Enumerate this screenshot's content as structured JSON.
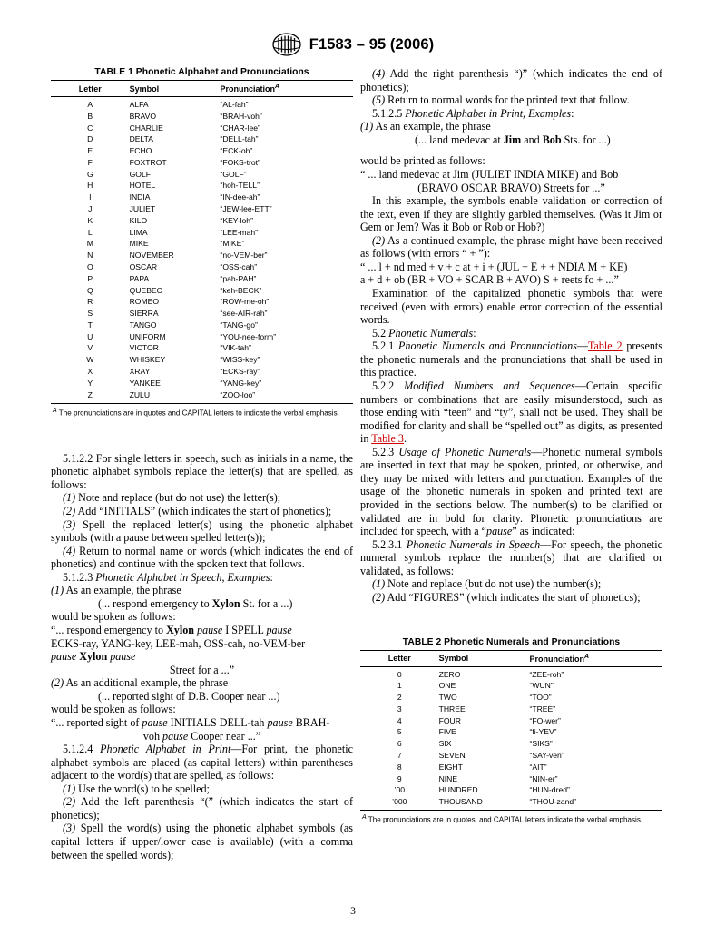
{
  "header": {
    "logo_name": "astm-logo",
    "title": "F1583 – 95 (2006)"
  },
  "page_number": "3",
  "table1": {
    "caption": "TABLE 1  Phonetic Alphabet and Pronunciations",
    "columns": [
      "Letter",
      "Symbol",
      "Pronunciation"
    ],
    "footnote_marker": "A",
    "rows": [
      [
        "A",
        "ALFA",
        "“AL-fah”"
      ],
      [
        "B",
        "BRAVO",
        "“BRAH-voh”"
      ],
      [
        "C",
        "CHARLIE",
        "“CHAR-lee”"
      ],
      [
        "D",
        "DELTA",
        "“DELL-tah”"
      ],
      [
        "E",
        "ECHO",
        "“ECK-oh”"
      ],
      [
        "F",
        "FOXTROT",
        "“FOKS-trot”"
      ],
      [
        "G",
        "GOLF",
        "“GOLF”"
      ],
      [
        "H",
        "HOTEL",
        "“hoh-TELL”"
      ],
      [
        "I",
        "INDIA",
        "“IN-dee-ah”"
      ],
      [
        "J",
        "JULIET",
        "“JEW-lee-ETT”"
      ],
      [
        "K",
        "KILO",
        "“KEY-loh”"
      ],
      [
        "L",
        "LIMA",
        "“LEE-mah”"
      ],
      [
        "M",
        "MIKE",
        "“MIKE”"
      ],
      [
        "N",
        "NOVEMBER",
        "“no-VEM-ber”"
      ],
      [
        "O",
        "OSCAR",
        "“OSS-cah”"
      ],
      [
        "P",
        "PAPA",
        "“pah-PAH”"
      ],
      [
        "Q",
        "QUEBEC",
        "“keh-BECK”"
      ],
      [
        "R",
        "ROMEO",
        "“ROW-me-oh”"
      ],
      [
        "S",
        "SIERRA",
        "“see-AIR-rah”"
      ],
      [
        "T",
        "TANGO",
        "“TANG-go”"
      ],
      [
        "U",
        "UNIFORM",
        "“YOU-nee-form”"
      ],
      [
        "V",
        "VICTOR",
        "“VIK-tah”"
      ],
      [
        "W",
        "WHISKEY",
        "“WISS-key”"
      ],
      [
        "X",
        "XRAY",
        "“ECKS-ray”"
      ],
      [
        "Y",
        "YANKEE",
        "“YANG-key”"
      ],
      [
        "Z",
        "ZULU",
        "“ZOO-loo”"
      ]
    ],
    "footnote": "The pronunciations are in quotes and CAPITAL letters to indicate the verbal emphasis."
  },
  "table2": {
    "caption": "TABLE 2  Phonetic Numerals and Pronunciations",
    "columns": [
      "Letter",
      "Symbol",
      "Pronunciation"
    ],
    "footnote_marker": "A",
    "rows": [
      [
        "0",
        "ZERO",
        "“ZEE-roh”"
      ],
      [
        "1",
        "ONE",
        "“WUN”"
      ],
      [
        "2",
        "TWO",
        "“TOO”"
      ],
      [
        "3",
        "THREE",
        "“TREE”"
      ],
      [
        "4",
        "FOUR",
        "“FO-wer”"
      ],
      [
        "5",
        "FIVE",
        "“fi-YEV”"
      ],
      [
        "6",
        "SIX",
        "“SIKS”"
      ],
      [
        "7",
        "SEVEN",
        "“SAY-ven”"
      ],
      [
        "8",
        "EIGHT",
        "“AIT”"
      ],
      [
        "9",
        "NINE",
        "“NIN-er”"
      ],
      [
        "’00",
        "HUNDRED",
        "“HUN-dred”"
      ],
      [
        "’000",
        "THOUSAND",
        "“THOU-zand”"
      ]
    ],
    "footnote": "The pronunciations are in quotes, and CAPITAL letters indicate the verbal emphasis."
  },
  "left_column": {
    "p_5122": "5.1.2.2 For single letters in speech, such as initials in a name, the phonetic alphabet symbols replace the letter(s) that are spelled, as follows:",
    "p_5122_1_num": "(1)",
    "p_5122_1": "Note and replace (but do not use) the letter(s);",
    "p_5122_2_num": "(2)",
    "p_5122_2": "Add “INITIALS” (which indicates the start of phonetics);",
    "p_5122_3_num": "(3)",
    "p_5122_3": "Spell the replaced letter(s) using the phonetic alphabet symbols (with a pause between spelled letter(s));",
    "p_5122_4_num": "(4)",
    "p_5122_4": "Return to normal name or words (which indicates the end of phonetics) and continue with the spoken text that follows.",
    "h_5123_num": "5.1.2.3",
    "h_5123_title": "Phonetic Alphabet in Speech, Examples",
    "h_5123_colon": ":",
    "ex1_num": "(1)",
    "ex1_lead": "As an example, the phrase",
    "ex1_phrase_a": "(... respond emergency to ",
    "ex1_phrase_bold": "Xylon",
    "ex1_phrase_b": " St. for a ...)",
    "ex1_spoken_lead": "would be spoken as follows:",
    "ex1_spoken_1a": "“... respond emergency to ",
    "ex1_spoken_1b": "Xylon",
    "ex1_spoken_1c": "pause",
    "ex1_spoken_1d": " I SPELL ",
    "ex1_spoken_1e": "pause",
    "ex1_spoken_2": "ECKS-ray, YANG-key, LEE-mah, OSS-cah, no-VEM-ber",
    "ex1_spoken_3a": "pause",
    "ex1_spoken_3b": "Xylon",
    "ex1_spoken_3c": "pause",
    "ex1_spoken_4": "Street for a ...”",
    "ex2_num": "(2)",
    "ex2_lead": "As an additional example, the phrase",
    "ex2_phrase": "(... reported sight of D.B. Cooper near ...)",
    "ex2_spoken_lead": "would be spoken as follows:",
    "ex2_spoken_1a": "“... reported sight of ",
    "ex2_spoken_1b": "pause",
    "ex2_spoken_1c": " INITIALS DELL-tah ",
    "ex2_spoken_1d": "pause",
    "ex2_spoken_1e": " BRAH-",
    "ex2_spoken_2a": "voh ",
    "ex2_spoken_2b": "pause",
    "ex2_spoken_2c": " Cooper near ...”",
    "h_5124_num": "5.1.2.4",
    "h_5124_title": "Phonetic Alphabet in Print",
    "h_5124_rest": "—For print, the phonetic alphabet symbols are placed (as capital letters) within parentheses adjacent to the word(s) that are spelled, as follows:",
    "p_5124_1_num": "(1)",
    "p_5124_1": "Use the word(s) to be spelled;",
    "p_5124_2_num": "(2)",
    "p_5124_2": "Add the left parenthesis “(” (which indicates the start of phonetics);",
    "p_5124_3_num": "(3)",
    "p_5124_3": "Spell the word(s) using the phonetic alphabet symbols (as capital letters if upper/lower case is available) (with a comma between the spelled words);"
  },
  "right_column": {
    "p_5124_4_num": "(4)",
    "p_5124_4": "Add the right parenthesis “)” (which indicates the end of phonetics);",
    "p_5124_5_num": "(5)",
    "p_5124_5": "Return to normal words for the printed text that follow.",
    "h_5125_num": "5.1.2.5",
    "h_5125_title": "Phonetic Alphabet in Print, Examples",
    "h_5125_colon": ":",
    "ex1_num": "(1)",
    "ex1_lead": "As an example, the phrase",
    "ex1_phrase_a": "(... land medevac at ",
    "ex1_phrase_b1": "Jim",
    "ex1_phrase_b2": " and ",
    "ex1_phrase_b3": "Bob",
    "ex1_phrase_c": " Sts. for ...)",
    "ex1_printed_lead": "would be printed as follows:",
    "ex1_printed_1": "“ ... land medevac at Jim (JULIET INDIA MIKE) and Bob",
    "ex1_printed_2": "(BRAVO OSCAR BRAVO) Streets for ...”",
    "p_inthis": "In this example, the symbols enable validation or correction of the text, even if they are slightly garbled themselves. (Was it Jim or Gem or Jem? Was it Bob or Rob or Hob?)",
    "ex2_num": "(2)",
    "ex2_lead": "As a continued example, the phrase might have been received as follows (with errors “ + ”):",
    "ex2_recv_1": "“ ... l + nd med + v + c at + i + (JUL + E +  + NDIA M + KE)",
    "ex2_recv_2": "a + d + ob (BR + VO + SCAR B + AVO) S + reets fo + ...”",
    "p_exam": "Examination of the capitalized phonetic symbols that were received (even with errors) enable error correction of the essential words.",
    "h_52_num": "5.2",
    "h_52_title": "Phonetic Numerals",
    "h_52_colon": ":",
    "h_521_num": "5.2.1",
    "h_521_title": "Phonetic Numerals and Pronunciations",
    "h_521_dash": "—",
    "h_521_xref": "Table 2",
    "h_521_rest": " presents the phonetic numerals and the pronunciations that shall be used in this practice.",
    "h_522_num": "5.2.2",
    "h_522_title": "Modified Numbers and Sequences",
    "h_522_rest_a": "—Certain specific numbers or combinations that are easily misunderstood, such as those ending with “teen” and “ty”, shall not be used. They shall be modified for clarity and shall be “spelled out” as digits, as presented in ",
    "h_522_xref": "Table 3",
    "h_522_rest_b": ".",
    "h_523_num": "5.2.3",
    "h_523_title": "Usage of Phonetic Numerals",
    "h_523_rest_a": "—Phonetic numeral symbols are inserted in text that may be spoken, printed, or otherwise, and they may be mixed with letters and punctuation. Examples of the usage of the phonetic numerals in spoken and printed text are provided in the sections below. The number(s) to be clarified or validated are in bold for clarity. Phonetic pronunciations are included for speech, with a “",
    "h_523_pause": "pause",
    "h_523_rest_b": "” as indicated:",
    "h_5231_num": "5.2.3.1",
    "h_5231_title": "Phonetic Numerals in Speech",
    "h_5231_rest": "—For speech, the phonetic numeral symbols replace the number(s) that are clarified or validated, as follows:",
    "p_5231_1_num": "(1)",
    "p_5231_1": "Note and replace (but do not use) the number(s);",
    "p_5231_2_num": "(2)",
    "p_5231_2": "Add “FIGURES” (which indicates the start of phonetics);"
  }
}
